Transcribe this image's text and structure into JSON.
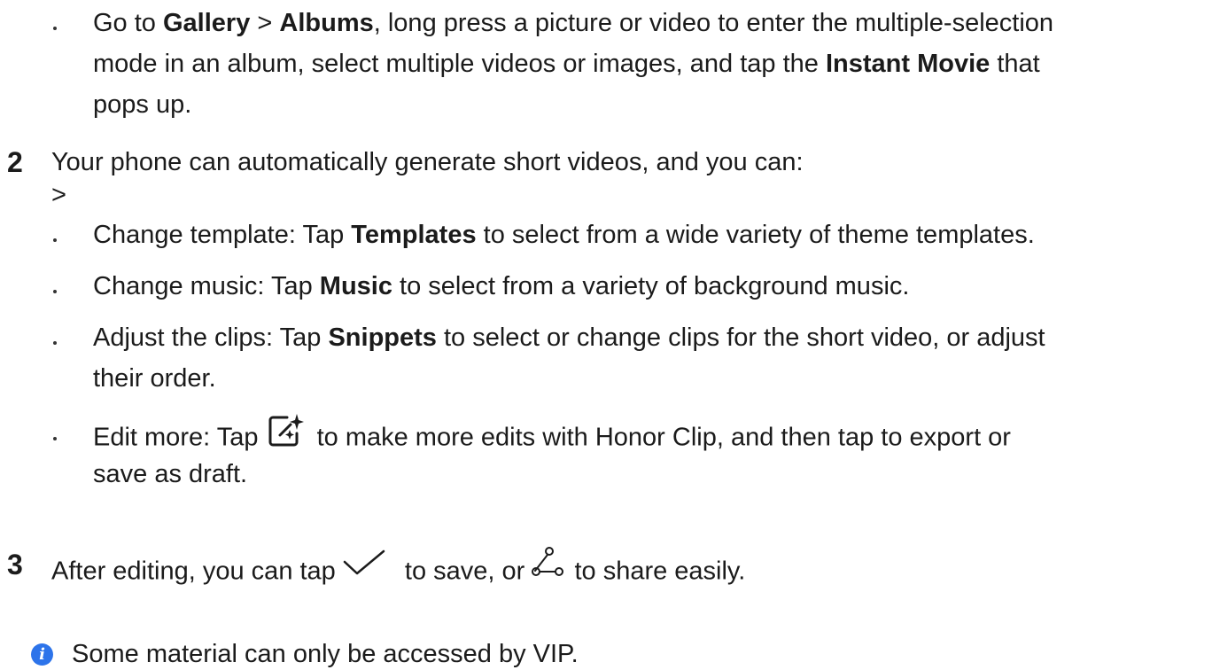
{
  "substeps_intro": {
    "line1": {
      "pre": "Go to ",
      "b1": "Gallery",
      "mid1": " > ",
      "b2": "Albums",
      "post": ", long press a picture or video to enter the multiple-selection"
    },
    "line2": {
      "pre": "mode in an album, select multiple videos or images, and tap the ",
      "b1": "Instant Movie",
      "post": " that"
    },
    "line3": "pops up."
  },
  "step2": {
    "number": "2",
    "text": "Your phone can automatically generate short videos, and you can:",
    "marker": ">",
    "items": [
      {
        "pre": "Change template: Tap ",
        "bold": "Templates",
        "post": " to select from a wide variety of theme templates."
      },
      {
        "pre": "Change music: Tap ",
        "bold": "Music",
        "post": " to select from a variety of background music."
      },
      {
        "pre": "Adjust the clips: Tap ",
        "bold": "Snippets",
        "post": " to select or change clips for the short video, or adjust",
        "cont": "their order."
      },
      {
        "pre": "Edit more: Tap ",
        "icon": "edit-sparkle-icon",
        "post": " to make more edits with Honor Clip, and then tap to export or",
        "cont": "save as draft."
      }
    ]
  },
  "step3": {
    "number": "3",
    "pre": "After editing, you can tap ",
    "icon1": "checkmark-icon",
    "mid": " to save, or ",
    "icon2": "share-icon",
    "post": " to share easily."
  },
  "note": {
    "icon": "info-icon",
    "icon_glyph": "i",
    "text": "Some material can only be accessed by VIP."
  },
  "colors": {
    "text": "#1b1b1b",
    "accent": "#2d74ea"
  }
}
